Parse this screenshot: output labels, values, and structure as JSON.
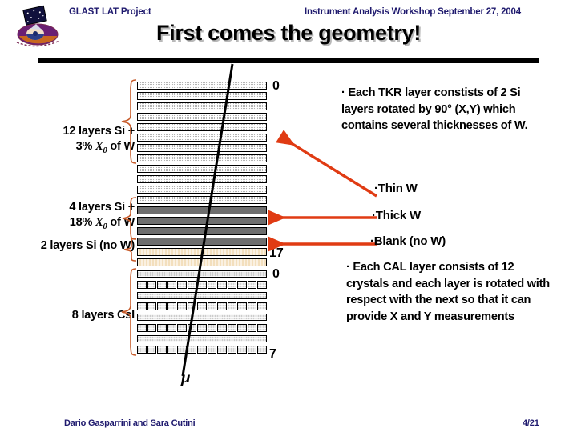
{
  "header": {
    "project": "GLAST LAT Project",
    "workshop": "Instrument Analysis Workshop  September  27, 2004",
    "title": "First comes the geometry!",
    "logo_icon": "glast-satellite-logo"
  },
  "captions": {
    "thin_line1": "12 layers Si +",
    "thin_line2_pre": "3% ",
    "thin_line2_x": "X",
    "thin_line2_sub": "0",
    "thin_line2_post": " of W",
    "thick_line1": "4 layers Si +",
    "thick_line2_pre": "18% ",
    "thick_line2_x": "X",
    "thick_line2_sub": "0",
    "thick_line2_post": "  of W",
    "blank_label": "2 layers Si (no W)",
    "csi_label": "8 layers CsI"
  },
  "indices": {
    "tkr_top": "0",
    "tkr_bottom": "17",
    "cal_top": "0",
    "cal_bottom": "7"
  },
  "track": {
    "particle_label": "μ"
  },
  "legend": {
    "thin": "·Thin W",
    "thick": "·Thick W",
    "blank": "·Blank (no W)"
  },
  "notes": {
    "tkr": "·  Each TKR layer constists of  2 Si layers rotated by 90° (X,Y) which contains several thicknesses of W.",
    "cal": "·   Each CAL layer consists of 12 crystals and each layer is rotated with respect with the next so that it can provide X and Y measurements"
  },
  "footer": {
    "authors": "Dario Gasparrini and Sara Cutini",
    "page": "4/21"
  },
  "colors": {
    "header_text": "#1f1a6e",
    "arrow": "#e03b13",
    "brace": "#c75b2a",
    "thin_layer": "#b3b3b3",
    "thick_layer": "#6e6e6e",
    "blank_layer": "#f3dfbd",
    "cal_layer": "#e9e9e9",
    "rule": "#000000"
  },
  "diagram": {
    "tkr_thin_count": 12,
    "tkr_thick_count": 4,
    "tkr_blank_count": 2,
    "cal_layer_count": 8,
    "cal_crystals_per_layer": 13
  }
}
